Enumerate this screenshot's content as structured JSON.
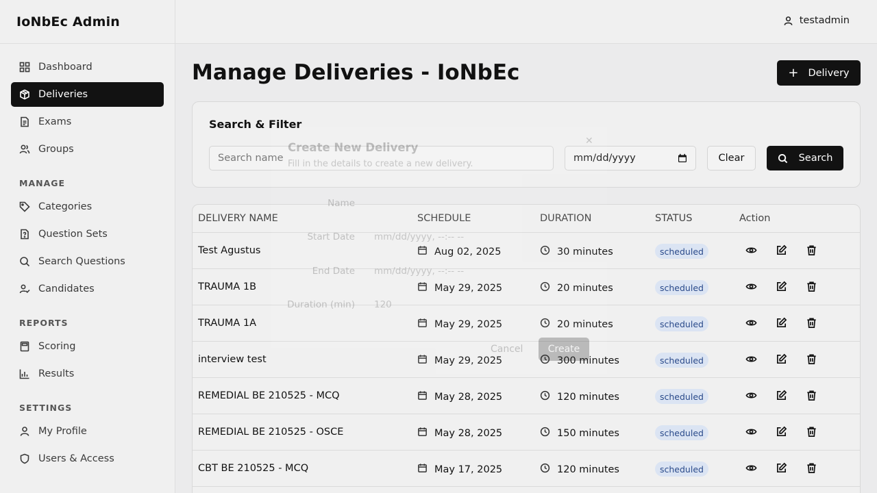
{
  "app": {
    "title": "IoNbEc Admin"
  },
  "user": {
    "name": "testadmin"
  },
  "sidebar": {
    "main_items": [
      {
        "label": "Dashboard",
        "icon": "grid-icon",
        "active": false
      },
      {
        "label": "Deliveries",
        "icon": "package-icon",
        "active": true
      },
      {
        "label": "Exams",
        "icon": "document-icon",
        "active": false
      },
      {
        "label": "Groups",
        "icon": "users-icon",
        "active": false
      }
    ],
    "sections": [
      {
        "title": "MANAGE",
        "items": [
          {
            "label": "Categories",
            "icon": "tag-icon"
          },
          {
            "label": "Question Sets",
            "icon": "question-file-icon"
          },
          {
            "label": "Search Questions",
            "icon": "search-icon"
          },
          {
            "label": "Candidates",
            "icon": "user-check-icon"
          }
        ]
      },
      {
        "title": "REPORTS",
        "items": [
          {
            "label": "Scoring",
            "icon": "calculator-icon"
          },
          {
            "label": "Results",
            "icon": "bar-chart-icon"
          }
        ]
      },
      {
        "title": "SETTINGS",
        "items": [
          {
            "label": "My Profile",
            "icon": "user-icon"
          },
          {
            "label": "Users & Access",
            "icon": "shield-icon"
          }
        ]
      }
    ]
  },
  "page": {
    "title": "Manage Deliveries - IoNbEc",
    "add_button": "Delivery"
  },
  "filter": {
    "title": "Search & Filter",
    "search_placeholder": "Search name",
    "date_placeholder": "mm/dd/yyyy",
    "clear_label": "Clear",
    "search_label": "Search"
  },
  "table": {
    "columns": [
      "DELIVERY NAME",
      "SCHEDULE",
      "DURATION",
      "STATUS",
      "Action"
    ],
    "rows": [
      {
        "name": "Test Agustus",
        "schedule": "Aug 02, 2025",
        "duration": "30 minutes",
        "status": "scheduled"
      },
      {
        "name": "TRAUMA 1B",
        "schedule": "May 29, 2025",
        "duration": "20 minutes",
        "status": "scheduled"
      },
      {
        "name": "TRAUMA 1A",
        "schedule": "May 29, 2025",
        "duration": "20 minutes",
        "status": "scheduled"
      },
      {
        "name": "interview test",
        "schedule": "May 29, 2025",
        "duration": "300 minutes",
        "status": "scheduled"
      },
      {
        "name": "REMEDIAL BE 210525 - MCQ",
        "schedule": "May 28, 2025",
        "duration": "120 minutes",
        "status": "scheduled"
      },
      {
        "name": "REMEDIAL BE 210525 - OSCE",
        "schedule": "May 28, 2025",
        "duration": "150 minutes",
        "status": "scheduled"
      },
      {
        "name": "CBT BE 210525 - MCQ",
        "schedule": "May 17, 2025",
        "duration": "120 minutes",
        "status": "scheduled"
      }
    ]
  },
  "dialog": {
    "title": "Create New Delivery",
    "description": "Fill in the details to create a new delivery.",
    "fields": [
      {
        "label": "Name",
        "value": ""
      },
      {
        "label": "Start Date",
        "value": "mm/dd/yyyy, --:-- --"
      },
      {
        "label": "End Date",
        "value": "mm/dd/yyyy, --:-- --"
      },
      {
        "label": "Duration (min)",
        "value": "120"
      }
    ],
    "cancel_label": "Cancel",
    "create_label": "Create"
  },
  "colors": {
    "accent": "#121212",
    "badge_bg": "#dbe4f3",
    "badge_text": "#2a4a8a"
  }
}
